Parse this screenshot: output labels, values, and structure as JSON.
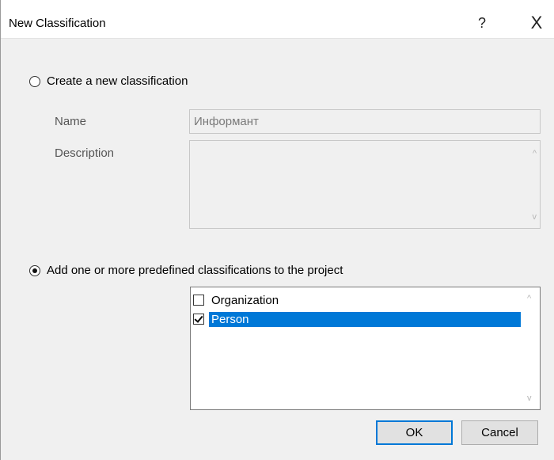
{
  "window": {
    "title": "New Classification",
    "help_glyph": "?",
    "close_glyph": "X"
  },
  "option_new": {
    "label": "Create a new classification",
    "selected": false
  },
  "fields": {
    "name_label": "Name",
    "name_value": "Информант",
    "description_label": "Description",
    "description_value": ""
  },
  "option_predefined": {
    "label": "Add one or more predefined classifications to the project",
    "selected": true
  },
  "classifications": [
    {
      "label": "Organization",
      "checked": false,
      "selected": false
    },
    {
      "label": "Person",
      "checked": true,
      "selected": true
    }
  ],
  "buttons": {
    "ok": "OK",
    "cancel": "Cancel"
  },
  "icons": {
    "scroll_up": "^",
    "scroll_down": "v"
  },
  "colors": {
    "selection": "#0078d7",
    "dialog_bg": "#f0f0f0"
  }
}
